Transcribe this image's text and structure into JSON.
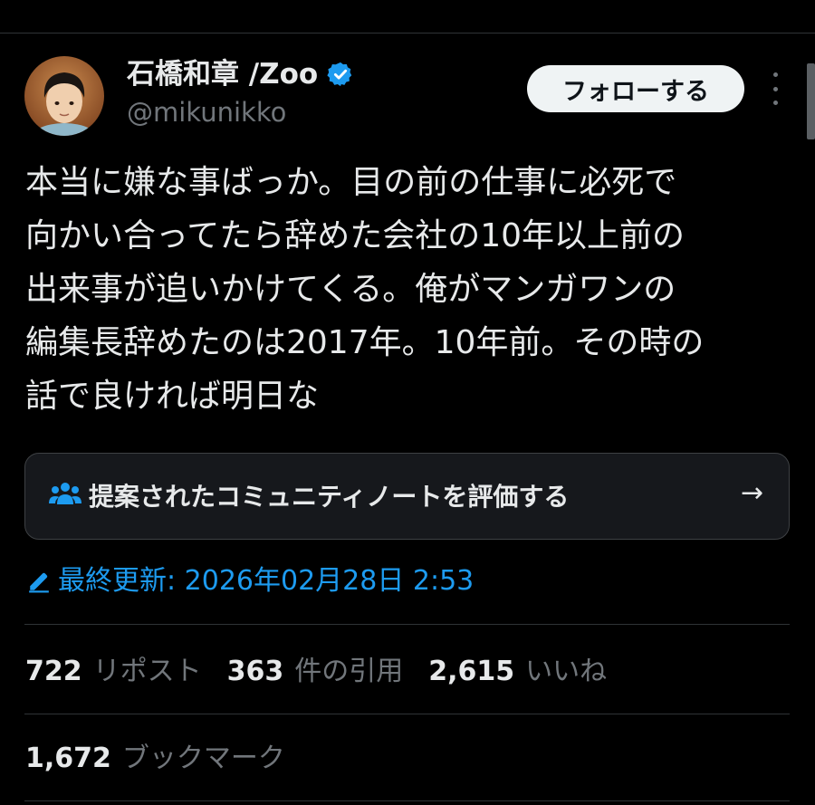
{
  "author": {
    "name": "石橋和章 /Zoo",
    "handle": "@mikunikko"
  },
  "actions": {
    "follow_label": "フォローする"
  },
  "tweet": {
    "text": "本当に嫌な事ばっか。目の前の仕事に必死で\n向かい合ってたら辞めた会社の10年以上前の\n出来事が追いかけてくる。俺がマンガワンの\n編集長辞めたのは2017年。10年前。その時の\n話で良ければ明日な"
  },
  "community_note": {
    "label": "提案されたコミュニティノートを評価する",
    "arrow": "→"
  },
  "edited": {
    "text": "最終更新: 2026年02月28日 2:53"
  },
  "stats": {
    "reposts": {
      "value": "722",
      "label": "リポスト"
    },
    "quotes": {
      "value": "363",
      "label": "件の引用"
    },
    "likes": {
      "value": "2,615",
      "label": "いいね"
    },
    "bookmarks": {
      "value": "1,672",
      "label": "ブックマーク"
    }
  },
  "colors": {
    "background": "#000000",
    "text": "#e7e9ea",
    "secondary": "#71767b",
    "accent": "#1d9bf0",
    "verified": "#1d9bf0"
  },
  "icons": {
    "verified": "verified-badge-icon",
    "community": "people-icon",
    "edit": "pencil-icon",
    "more": "more-dots-icon"
  }
}
